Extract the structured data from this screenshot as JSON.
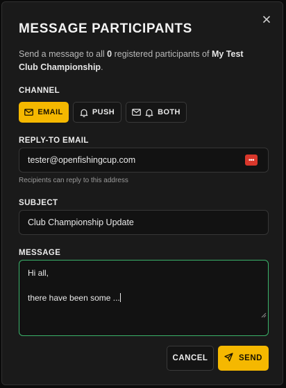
{
  "modal": {
    "title": "MESSAGE PARTICIPANTS",
    "close_icon": "close-icon",
    "description": {
      "prefix": "Send a message to all ",
      "count": "0",
      "middle": " registered participants of ",
      "event": "My Test Club Championship",
      "suffix": "."
    }
  },
  "channel": {
    "label": "CHANNEL",
    "selected": "EMAIL",
    "options": [
      {
        "label": "EMAIL",
        "icon": "mail-icon"
      },
      {
        "label": "PUSH",
        "icon": "bell-icon"
      },
      {
        "label": "BOTH",
        "icon": "mail-bell-icon"
      }
    ]
  },
  "reply_to": {
    "label": "REPLY-TO EMAIL",
    "value": "tester@openfishingcup.com",
    "hint": "Recipients can reply to this address",
    "badge": "•••"
  },
  "subject": {
    "label": "SUBJECT",
    "value": "Club Championship Update"
  },
  "message": {
    "label": "MESSAGE",
    "value": "Hi all,\n\nthere have been some ..."
  },
  "actions": {
    "cancel": "CANCEL",
    "send": "SEND"
  },
  "colors": {
    "accent": "#f5b800",
    "focus_border": "#3bb36a",
    "background": "#1a1a1a",
    "badge": "#d9372b"
  }
}
